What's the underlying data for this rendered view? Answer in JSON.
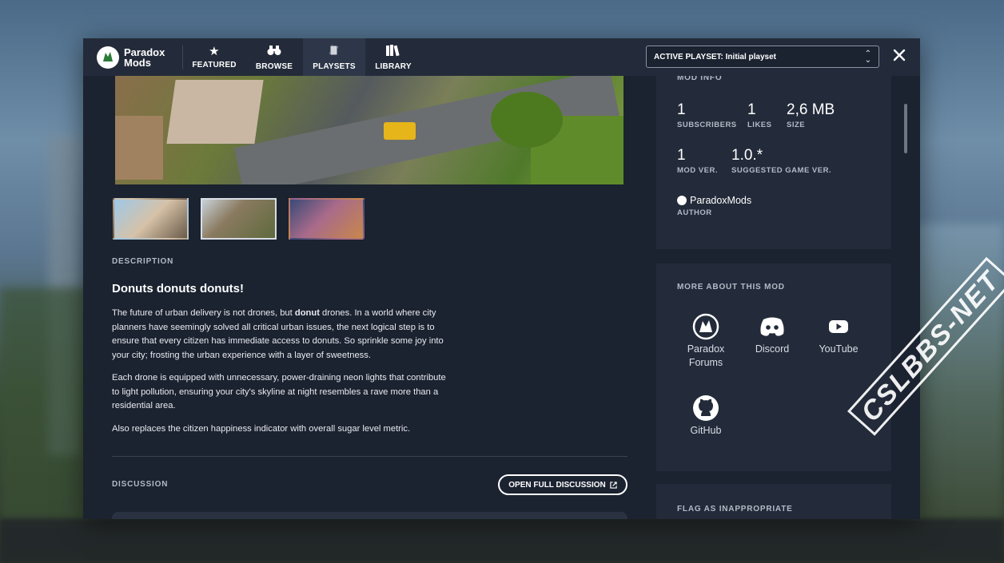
{
  "app": {
    "logo_line1": "Paradox",
    "logo_line2": "Mods"
  },
  "nav": {
    "tabs": [
      {
        "label": "FEATURED",
        "icon": "star-icon"
      },
      {
        "label": "BROWSE",
        "icon": "binoculars-icon"
      },
      {
        "label": "PLAYSETS",
        "icon": "cards-icon",
        "active": true
      },
      {
        "label": "LIBRARY",
        "icon": "books-icon"
      }
    ],
    "active_playset": "ACTIVE PLAYSET: Initial playset"
  },
  "description": {
    "label": "DESCRIPTION",
    "title": "Donuts donuts donuts!",
    "p1_before": "The future of urban delivery is not drones, but ",
    "p1_bold": "donut",
    "p1_after": " drones. In a world where city planners have seemingly solved all critical urban issues, the next logical step is to ensure that every citizen has immediate access to donuts. So sprinkle some joy into your city; frosting the urban experience with a layer of sweetness.",
    "p2": "Each drone is equipped with unnecessary, power-draining neon lights that contribute to light pollution, ensuring your city's skyline at night resembles a rave more than a residential area.",
    "p3": "Also replaces the citizen happiness indicator with overall sugar level metric."
  },
  "discussion": {
    "label": "DISCUSSION",
    "open_button": "OPEN FULL DISCUSSION"
  },
  "mod_info": {
    "label": "MOD INFO",
    "subscribers": {
      "value": "1",
      "caption": "SUBSCRIBERS"
    },
    "likes": {
      "value": "1",
      "caption": "LIKES"
    },
    "size": {
      "value": "2,6 MB",
      "caption": "SIZE"
    },
    "mod_ver": {
      "value": "1",
      "caption": "MOD VER."
    },
    "game_ver": {
      "value": "1.0.*",
      "caption": "SUGGESTED GAME VER."
    },
    "author": {
      "value": "ParadoxMods",
      "caption": "AUTHOR"
    }
  },
  "more_about": {
    "label": "MORE ABOUT THIS MOD",
    "links": [
      {
        "label": "Paradox Forums",
        "icon": "paradox-forums-icon"
      },
      {
        "label": "Discord",
        "icon": "discord-icon"
      },
      {
        "label": "YouTube",
        "icon": "youtube-icon"
      },
      {
        "label": "GitHub",
        "icon": "github-icon"
      }
    ]
  },
  "flag": {
    "label": "FLAG AS INAPPROPRIATE"
  },
  "watermark": "CSLBBS-NET"
}
